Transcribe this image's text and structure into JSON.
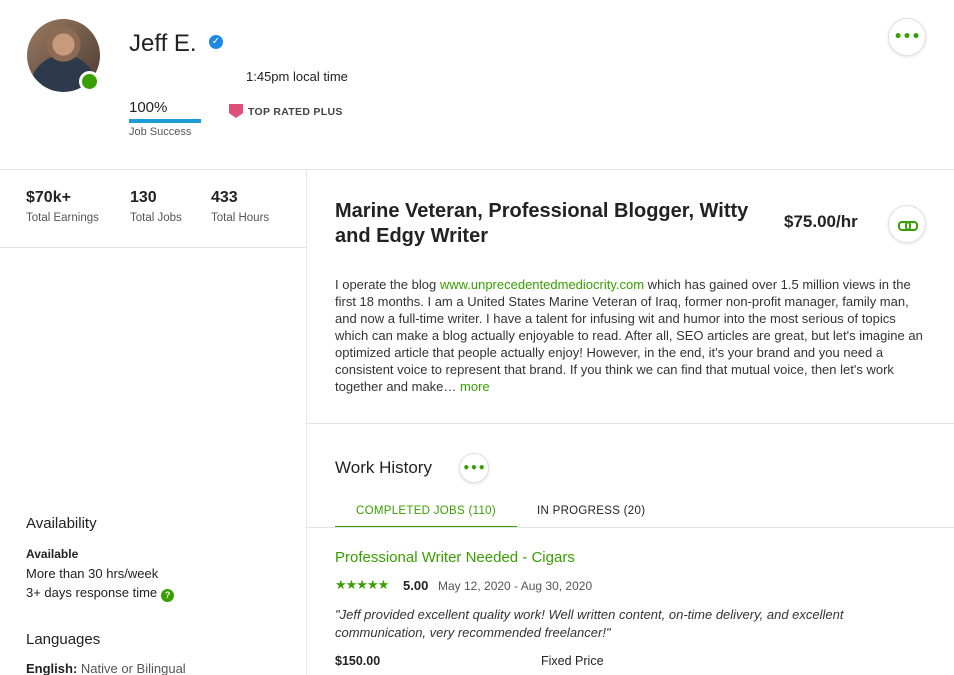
{
  "profile": {
    "name": "Jeff E.",
    "local_time": "1:45pm local time",
    "job_success": {
      "value": "100%",
      "label": "Job Success",
      "percent": 100
    },
    "badge": "TOP RATED PLUS"
  },
  "stats": [
    {
      "value": "$70k+",
      "label": "Total Earnings"
    },
    {
      "value": "130",
      "label": "Total Jobs"
    },
    {
      "value": "433",
      "label": "Total Hours"
    }
  ],
  "availability": {
    "title": "Availability",
    "status": "Available",
    "hours": "More than 30 hrs/week",
    "response": "3+ days response time"
  },
  "languages": {
    "title": "Languages",
    "items": [
      {
        "name": "English:",
        "level": "Native or Bilingual"
      }
    ]
  },
  "overview": {
    "title": "Marine Veteran, Professional Blogger, Witty and Edgy Writer",
    "rate": "$75.00/hr",
    "desc_prefix": "I operate the blog ",
    "desc_link": "www.unprecedentedmediocrity.com",
    "desc_rest": " which has gained over 1.5 million views in the first 18 months. I am a United States Marine Veteran of Iraq, former non-profit manager, family man, and now a full-time writer. I have a talent for infusing wit and humor into the most serious of topics which can make a blog actually enjoyable to read. After all, SEO articles are great, but let's imagine an optimized article that people actually enjoy! However, in the end, it's your brand and you need a consistent voice to represent that brand. If you think we can find that mutual voice, then let's work together and make…",
    "more": "more"
  },
  "work_history": {
    "title": "Work History",
    "tabs": [
      {
        "label": "COMPLETED JOBS (110)",
        "active": true
      },
      {
        "label": "IN PROGRESS (20)",
        "active": false
      }
    ],
    "jobs": [
      {
        "title": "Professional Writer Needed - Cigars",
        "stars": "★★★★★",
        "rating": "5.00",
        "dates": "May 12, 2020 - Aug 30, 2020",
        "feedback": "\"Jeff provided excellent quality work! Well written content, on-time delivery, and excellent communication, very recommended freelancer!\"",
        "price": "$150.00",
        "type": "Fixed Price"
      }
    ]
  },
  "icons": {
    "verified": "verified-badge-icon",
    "more": "ellipsis-icon",
    "link": "link-icon",
    "help": "question-icon",
    "star": "star-icon"
  },
  "colors": {
    "accent": "#37a000",
    "job_success_bar": "#1d9bd7",
    "badge": "#e04e7a",
    "verified": "#1e88e5"
  }
}
